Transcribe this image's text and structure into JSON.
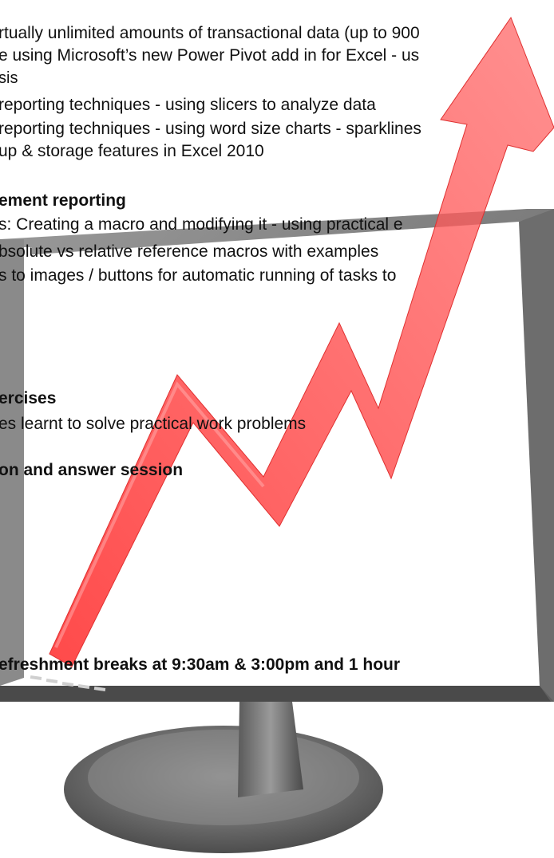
{
  "lines": {
    "l1": "rtually unlimited amounts of transactional data (up to 900",
    "l2": "e using Microsoft’s new Power Pivot add in for Excel  - us",
    "l3": "sis",
    "l4": " reporting techniques - using slicers to analyze data",
    "l5": " reporting techniques - using word size charts - sparklines",
    "l6": "up & storage features in Excel 2010",
    "h1": "ement reporting",
    "l7": "s: Creating a macro and modifying it - using practical e",
    "l8": "bsolute vs relative reference macros with examples",
    "l9": "s to images / buttons for automatic running of tasks to",
    "h2": "ercises",
    "l10": "es learnt to solve practical work problems",
    "h3": "on and answer session",
    "footer": "efreshment breaks at 9:30am & 3:00pm and 1 hour"
  },
  "colors": {
    "arrow": "#f24a4a",
    "arrow_light": "#ff8a8a",
    "monitor_frame": "#7a7a7a",
    "monitor_dark": "#3a3a3a",
    "screen": "#ffffff"
  },
  "icons": {
    "monitor": "monitor-illustration",
    "arrow": "growth-arrow-illustration"
  }
}
